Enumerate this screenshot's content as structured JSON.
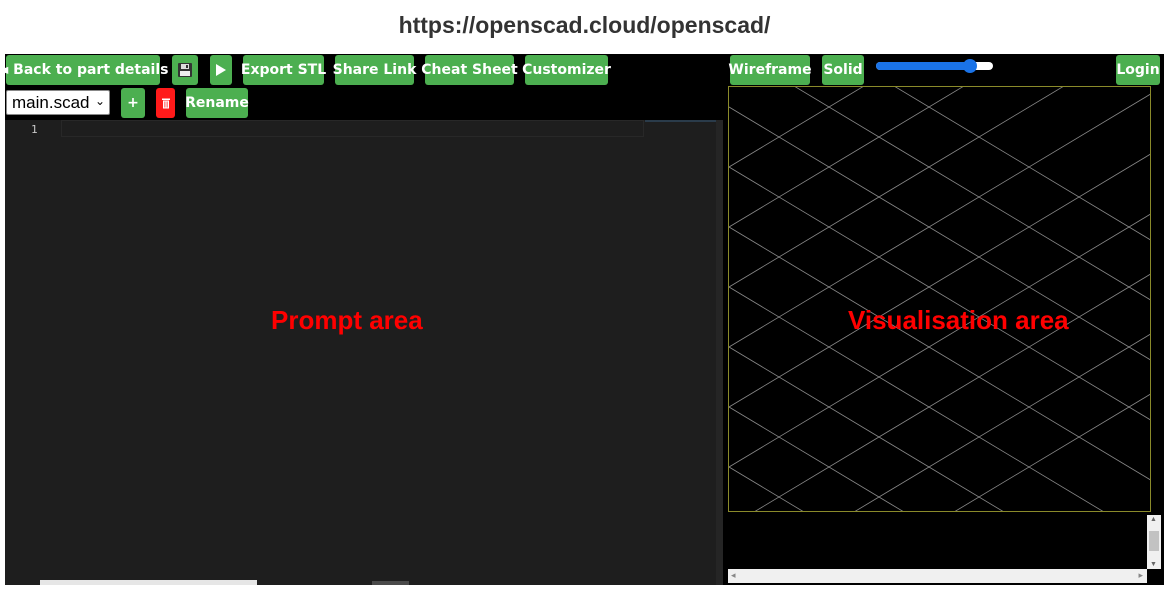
{
  "page": {
    "url_title": "https://openscad.cloud/openscad/"
  },
  "toolbar": {
    "back_label": "◄ Back to part details",
    "save_icon": "floppy-disk-icon",
    "run_icon": "play-icon",
    "export_label": "Export STL",
    "share_label": "Share Link",
    "cheat_label": "Cheat Sheet",
    "customizer_label": "Customizer",
    "wireframe_label": "Wireframe",
    "solid_label": "Solid",
    "login_label": "Login",
    "zoom_slider_fraction": 0.84
  },
  "file_bar": {
    "selected_file": "main.scad",
    "add_label": "+",
    "delete_icon": "trash-icon",
    "rename_label": "Rename"
  },
  "editor": {
    "line_numbers": [
      "1"
    ]
  },
  "annotations": {
    "prompt_label": "Prompt area",
    "visualisation_label": "Visualisation area",
    "color": "#ff0000"
  },
  "colors": {
    "accent": "#4caf50",
    "danger": "#ff1a1a",
    "editor_bg": "#1e1e1e",
    "slider": "#1a73e8"
  }
}
